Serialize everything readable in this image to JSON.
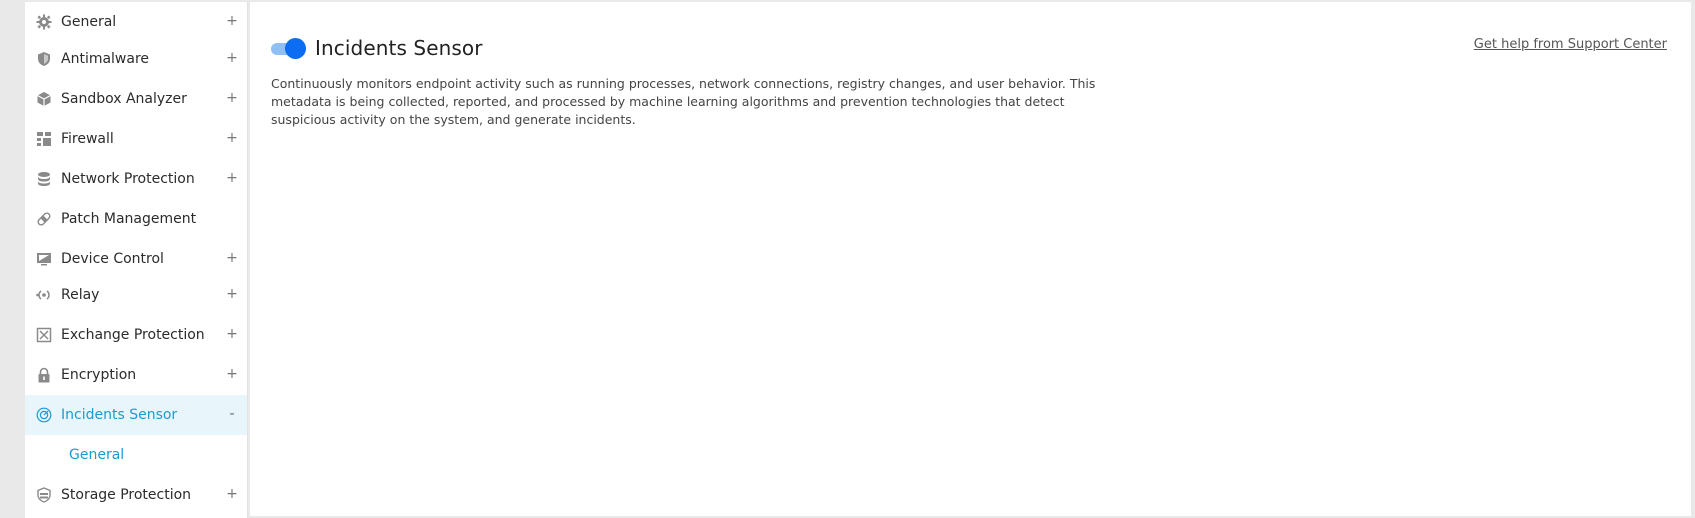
{
  "sidebar": {
    "items": [
      {
        "label": "General",
        "icon": "gear-icon",
        "toggle": "+"
      },
      {
        "label": "Antimalware",
        "icon": "shield-icon",
        "toggle": "+"
      },
      {
        "label": "Sandbox Analyzer",
        "icon": "cube-icon",
        "toggle": "+"
      },
      {
        "label": "Firewall",
        "icon": "firewall-icon",
        "toggle": "+"
      },
      {
        "label": "Network Protection",
        "icon": "database-icon",
        "toggle": "+"
      },
      {
        "label": "Patch Management",
        "icon": "bandage-icon",
        "toggle": ""
      },
      {
        "label": "Device Control",
        "icon": "monitor-icon",
        "toggle": "+"
      },
      {
        "label": "Relay",
        "icon": "relay-icon",
        "toggle": "+"
      },
      {
        "label": "Exchange Protection",
        "icon": "exchange-icon",
        "toggle": "+"
      },
      {
        "label": "Encryption",
        "icon": "lock-icon",
        "toggle": "+"
      },
      {
        "label": "Incidents Sensor",
        "icon": "sensor-icon",
        "toggle": "-"
      },
      {
        "label": "Storage Protection",
        "icon": "storage-icon",
        "toggle": "+"
      }
    ],
    "sub_items": [
      {
        "label": "General"
      }
    ]
  },
  "main": {
    "title": "Incidents Sensor",
    "enabled": true,
    "help_link": "Get help from Support Center",
    "description": "Continuously monitors endpoint activity such as running processes, network connections, registry changes, and user behavior. This metadata is being collected, reported, and processed by machine learning algorithms and prevention technologies that detect suspicious activity on the system, and generate incidents."
  },
  "colors": {
    "accent": "#1a9bd1",
    "active_bg": "#e8f6fc",
    "switch_on": "#0c6cf2",
    "switch_track": "#8fbff3"
  }
}
